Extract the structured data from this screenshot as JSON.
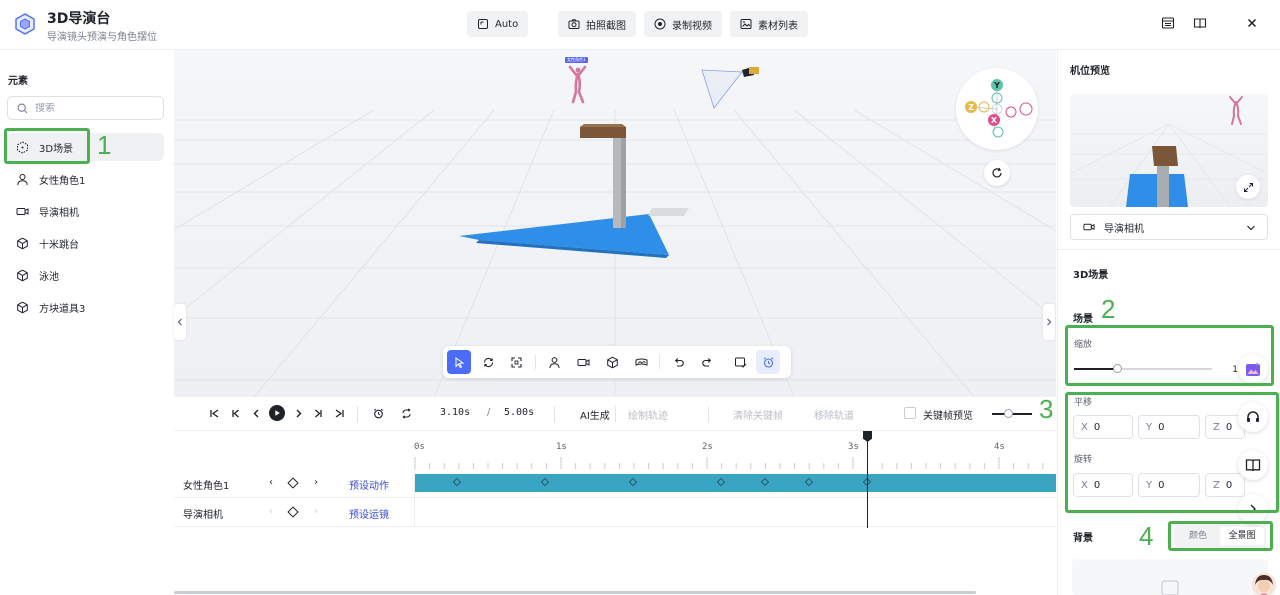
{
  "header": {
    "title": "3D导演台",
    "subtitle": "导演镜头预演与角色摆位",
    "auto_label": "Auto",
    "photo_label": "拍照截图",
    "record_label": "录制视频",
    "assets_label": "素材列表"
  },
  "sidebar": {
    "section_title": "元素",
    "search_placeholder": "搜索",
    "items": [
      {
        "label": "3D场景",
        "icon": "scene-icon"
      },
      {
        "label": "女性角色1",
        "icon": "person-icon"
      },
      {
        "label": "导演相机",
        "icon": "video-camera-icon"
      },
      {
        "label": "十米跳台",
        "icon": "cube-icon"
      },
      {
        "label": "泳池",
        "icon": "cube-icon"
      },
      {
        "label": "方块道具3",
        "icon": "cube-icon"
      }
    ]
  },
  "viewport": {
    "camera_tag": "女性角色1",
    "gizmo_axes": [
      "Y",
      "Z",
      "X"
    ]
  },
  "timeline": {
    "current_time": "3.10s",
    "separator": "/",
    "total_time": "5.00s",
    "ai_generate": "AI生成",
    "draw_track": "绘制轨迹",
    "clear_keyframes": "清除关键帧",
    "remove_track": "移除轨道",
    "keyframe_preview": "关键帧预览",
    "ticks": [
      "0s",
      "1s",
      "2s",
      "3s",
      "4s"
    ],
    "tracks": [
      {
        "name": "女性角色1",
        "preset": "预设动作"
      },
      {
        "name": "导演相机",
        "preset": "预设运镜"
      }
    ],
    "playhead_seconds": 3.1
  },
  "right_panel": {
    "title": "机位预览",
    "camera_select": "导演相机",
    "scene_title": "3D场景",
    "scene_section": "场景",
    "scale_label": "缩放",
    "scale_value": "1",
    "translate_label": "平移",
    "translate": {
      "x": "0",
      "y": "0",
      "z": "0"
    },
    "rotate_label": "旋转",
    "rotate": {
      "x": "0",
      "y": "0",
      "z": "0"
    },
    "axis_x": "X",
    "axis_y": "Y",
    "axis_z": "Z",
    "background_label": "背景",
    "bg_option_color": "颜色",
    "bg_option_panorama": "全景图"
  },
  "annotations": [
    "1",
    "2",
    "3",
    "4"
  ],
  "colors": {
    "accent": "#4a6cf7",
    "clip": "#3aa5c2",
    "annotation": "#4caf50",
    "pool": "#2f8fe8"
  }
}
